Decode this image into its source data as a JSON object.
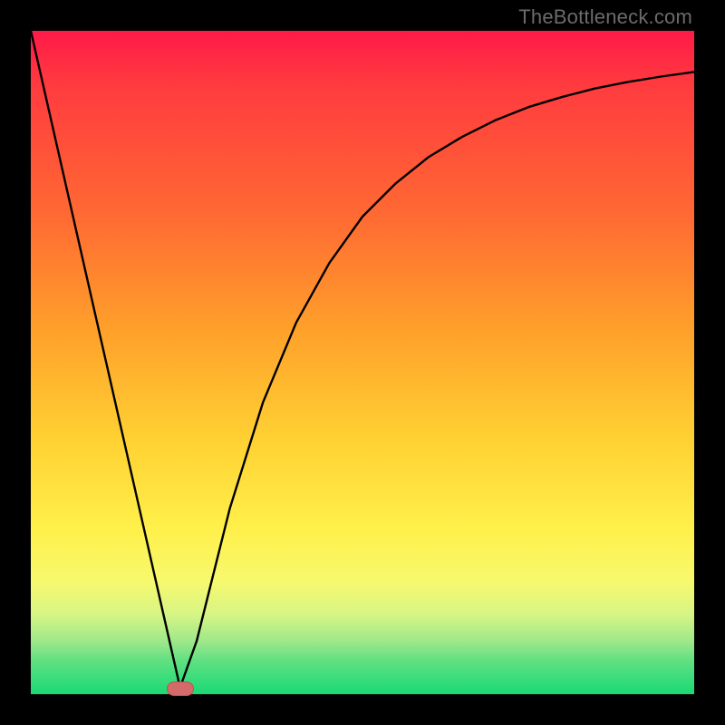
{
  "watermark": "TheBottleneck.com",
  "chart_data": {
    "type": "line",
    "title": "",
    "xlabel": "",
    "ylabel": "",
    "xlim": [
      0,
      100
    ],
    "ylim": [
      0,
      100
    ],
    "grid": false,
    "series": [
      {
        "name": "curve",
        "x": [
          0,
          5,
          10,
          15,
          20,
          22.5,
          25,
          27,
          30,
          35,
          40,
          45,
          50,
          55,
          60,
          65,
          70,
          75,
          80,
          85,
          90,
          95,
          100
        ],
        "y": [
          100,
          78,
          56,
          34,
          12,
          1,
          8,
          16,
          28,
          44,
          56,
          65,
          72,
          77,
          81,
          84,
          86.5,
          88.5,
          90,
          91.3,
          92.3,
          93.1,
          93.8
        ]
      }
    ],
    "marker": {
      "x": 22.5,
      "y": 0.8
    },
    "background_gradient": {
      "top": "#ff1a48",
      "bottom": "#1ad975"
    }
  }
}
